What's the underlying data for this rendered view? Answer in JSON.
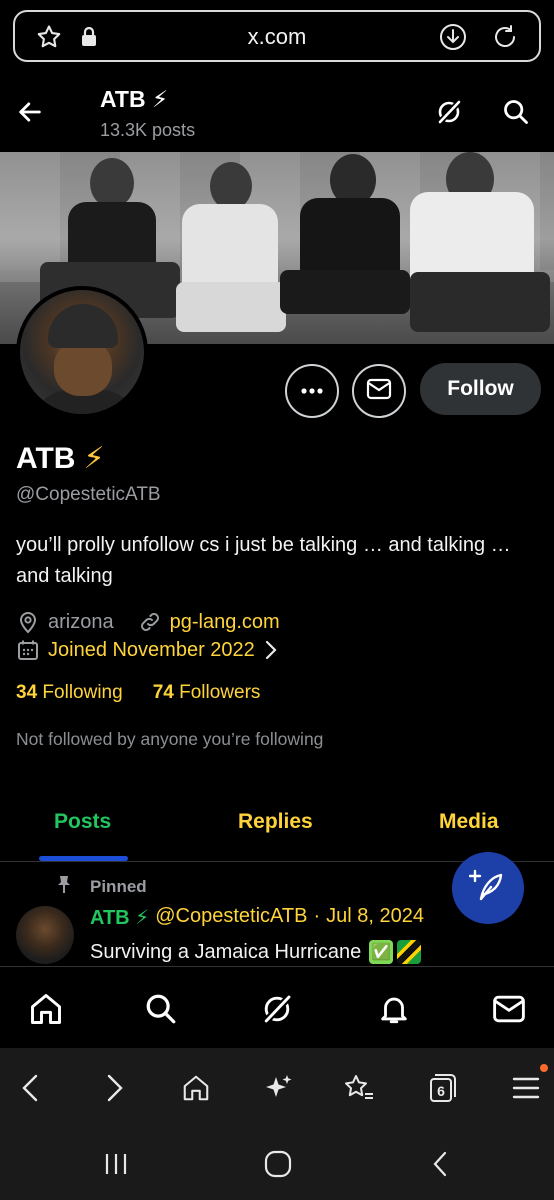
{
  "browser": {
    "url": "x.com"
  },
  "header": {
    "title": "ATB ⚡",
    "posts_count": "13.3K posts"
  },
  "profile": {
    "display_name": "ATB",
    "badge_emoji": "⚡",
    "handle": "@CopesteticATB",
    "bio": "you’ll prolly unfollow cs i just be talking … and talking … and talking",
    "location": "arizona",
    "website": "pg-lang.com",
    "joined": "Joined November 2022",
    "following_count": "34",
    "following_label": "Following",
    "followers_count": "74",
    "followers_label": "Followers",
    "not_followed_text": "Not followed by anyone you’re following"
  },
  "actions": {
    "follow_label": "Follow"
  },
  "tabs": [
    {
      "label": "Posts",
      "active": true
    },
    {
      "label": "Replies"
    },
    {
      "label": "Media"
    }
  ],
  "pinned_tweet": {
    "pinned_label": "Pinned",
    "author": "ATB ⚡",
    "handle": "@CopesteticATB",
    "separator": "·",
    "date": "Jul 8, 2024",
    "text": "Surviving a Jamaica Hurricane",
    "emoji_1": "✅",
    "emoji_2": "🇯🇲"
  },
  "colors": {
    "accent_yellow": "#ffd43b",
    "accent_green": "#22c55e",
    "fab_blue": "#1d3fa8",
    "tab_indicator": "#1d4ed8"
  },
  "icons": {
    "x_nav": [
      "home-icon",
      "search-icon",
      "grok-icon",
      "notifications-bell-icon",
      "messages-mail-icon"
    ],
    "browser_nav": [
      "back-icon",
      "forward-icon",
      "home-icon",
      "ai-sparkle-icon",
      "bookmarks-star-icon",
      "tabs-icon",
      "menu-icon"
    ],
    "tabs_count": "6"
  }
}
